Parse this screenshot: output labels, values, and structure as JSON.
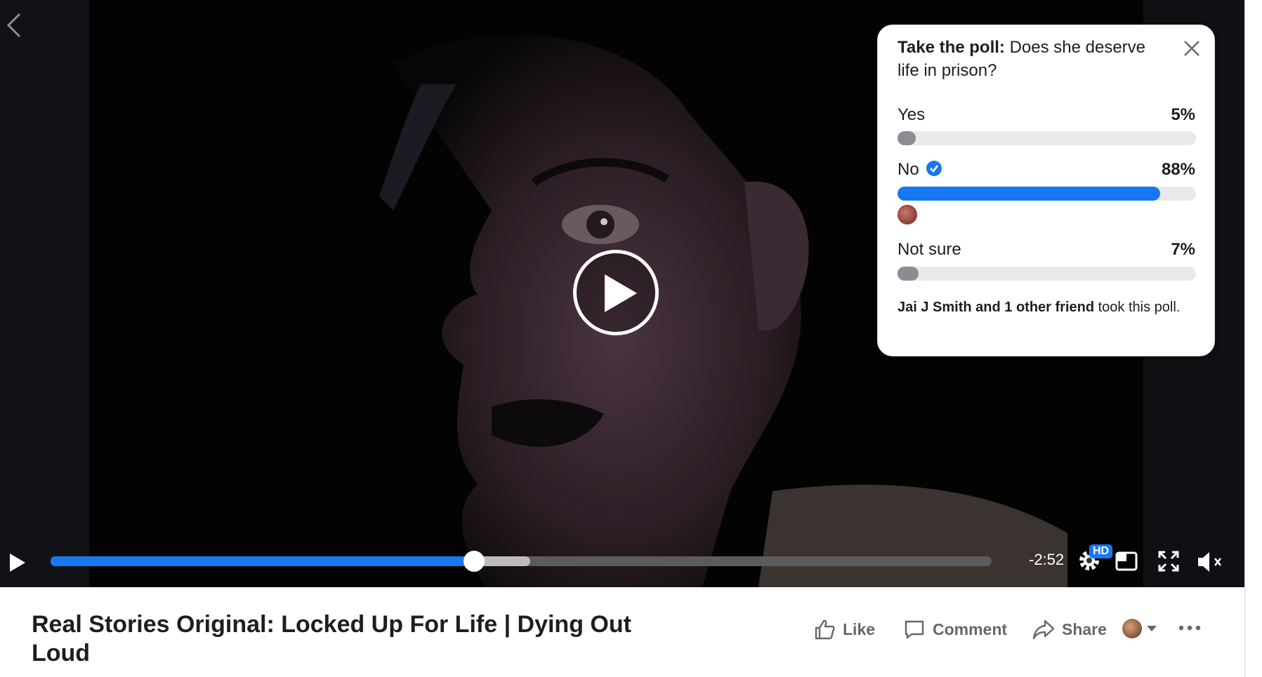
{
  "poll": {
    "question_prefix": "Take the poll:",
    "question": "Does she deserve life in prison?",
    "options": [
      {
        "label": "Yes",
        "percent_text": "5%",
        "percent": 5,
        "color": "#8a8d91"
      },
      {
        "label": "No",
        "percent_text": "88%",
        "percent": 88,
        "color": "#1877f2",
        "selected": true
      },
      {
        "label": "Not sure",
        "percent_text": "7%",
        "percent": 7,
        "color": "#8a8d91"
      }
    ],
    "footer_bold": "Jai J Smith and 1 other friend",
    "footer_rest": "took this poll."
  },
  "player": {
    "time_remaining": "-2:52",
    "quality_badge": "HD",
    "progress": 0.45,
    "buffered": 0.51
  },
  "video_title": "Real Stories Original: Locked Up For Life | Dying Out Loud",
  "actions": {
    "like": "Like",
    "comment": "Comment",
    "share": "Share"
  },
  "colors": {
    "accent": "#1877f2",
    "muted_text": "#65676b"
  },
  "icons": [
    "back-arrow-icon",
    "play-icon",
    "close-icon",
    "check-icon",
    "gear-icon",
    "pip-icon",
    "fullscreen-icon",
    "mute-icon",
    "like-icon",
    "comment-icon",
    "share-icon",
    "more-icon"
  ]
}
